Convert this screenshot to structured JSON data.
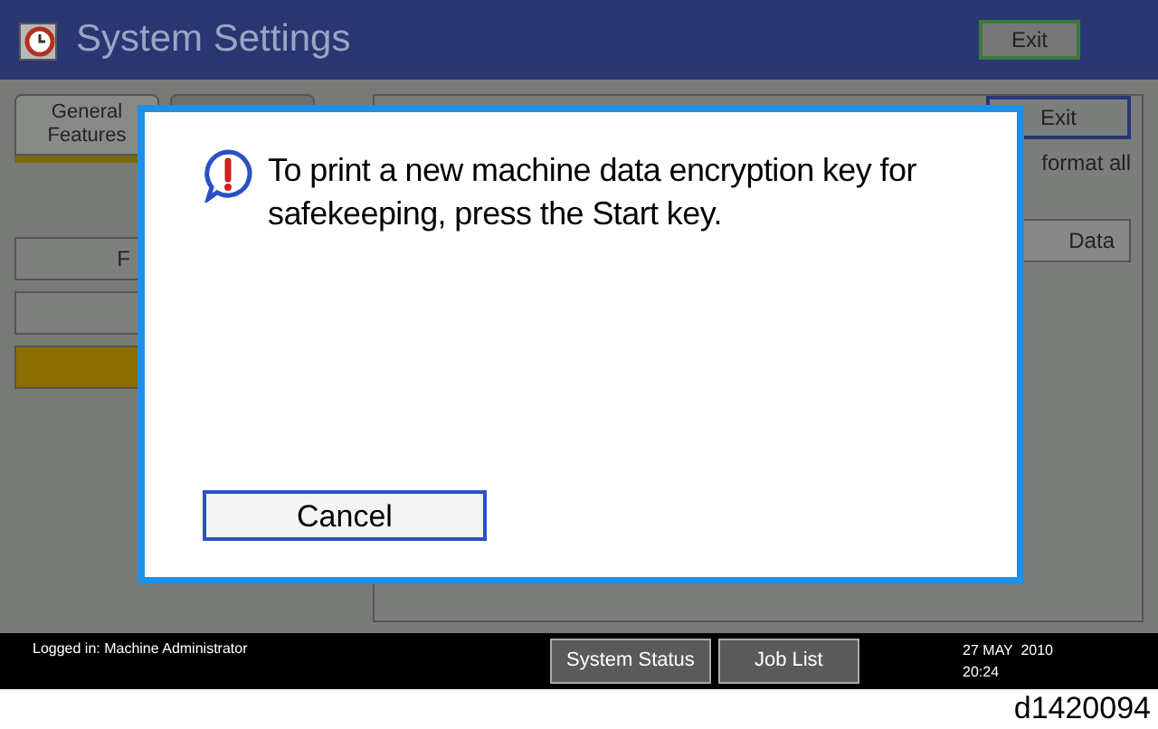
{
  "header": {
    "title": "System Settings",
    "exit_button": "Exit"
  },
  "tabs": [
    {
      "label": "General Features",
      "selected": true
    },
    {
      "selected": false
    }
  ],
  "left_buttons": [
    {
      "label": "F",
      "highlighted": false
    },
    {
      "highlighted": false
    },
    {
      "highlighted": true
    }
  ],
  "panel": {
    "exit_button": "Exit",
    "note": "format all",
    "data_button": "Data"
  },
  "dialog": {
    "message": "To print a new machine data encryption key for safekeeping, press the Start key.",
    "cancel_button": "Cancel"
  },
  "status_bar": {
    "login": "Logged in: Machine Administrator",
    "buttons": [
      "System Status",
      "Job List"
    ],
    "date": "27 MAY  2010",
    "time": "20:24"
  },
  "caption": "d1420094"
}
